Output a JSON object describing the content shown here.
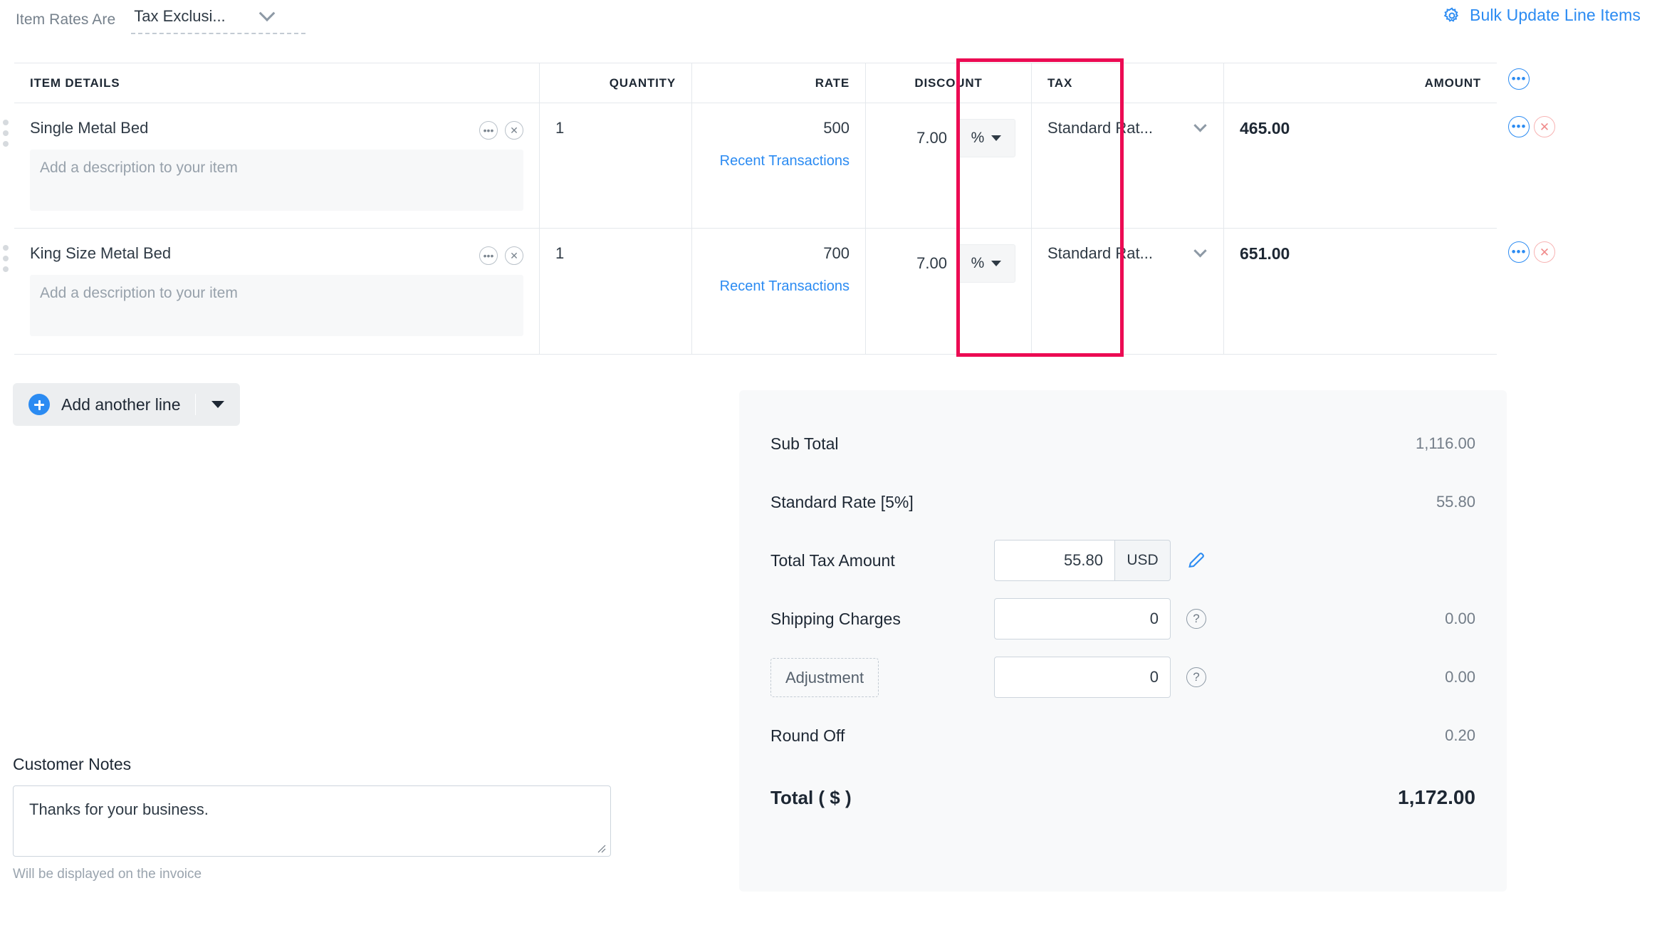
{
  "toolbar": {
    "rates_label": "Item Rates Are",
    "rates_value": "Tax Exclusi...",
    "bulk_update_label": "Bulk Update Line Items",
    "gear_icon": "gear-icon",
    "chevron_icon": "chevron-down-icon"
  },
  "table": {
    "headers": {
      "item_details": "ITEM DETAILS",
      "quantity": "QUANTITY",
      "rate": "RATE",
      "discount": "DISCOUNT",
      "tax": "TAX",
      "amount": "AMOUNT"
    },
    "header_more_icon": "more-options-icon",
    "description_placeholder": "Add a description to your item",
    "recent_transactions_label": "Recent Transactions",
    "rows": [
      {
        "name": "Single Metal Bed",
        "quantity": "1",
        "rate": "500",
        "discount": "7.00",
        "discount_unit": "%",
        "tax": "Standard Rat...",
        "amount": "465.00",
        "description": "",
        "description_placeholder": "Add a description to your item"
      },
      {
        "name": "King Size Metal Bed",
        "quantity": "1",
        "rate": "700",
        "discount": "7.00",
        "discount_unit": "%",
        "tax": "Standard Rat...",
        "amount": "651.00",
        "description": "",
        "description_placeholder": "Add a description to your item"
      }
    ]
  },
  "highlight": {
    "color": "#ec0b53",
    "target": "DISCOUNT"
  },
  "add_line": {
    "label": "Add another line",
    "plus_icon": "plus-circle-icon",
    "caret_icon": "caret-down-icon"
  },
  "summary": {
    "sub_total_label": "Sub Total",
    "sub_total_value": "1,116.00",
    "tax_rate_label": "Standard Rate [5%]",
    "tax_rate_value": "55.80",
    "total_tax_label": "Total Tax Amount",
    "total_tax_value": "55.80",
    "total_tax_currency": "USD",
    "edit_icon": "pencil-icon",
    "shipping_label": "Shipping Charges",
    "shipping_value": "0",
    "shipping_amount": "0.00",
    "adjustment_label": "Adjustment",
    "adjustment_value": "0",
    "adjustment_amount": "0.00",
    "round_off_label": "Round Off",
    "round_off_value": "0.20",
    "total_label": "Total ( $ )",
    "total_value": "1,172.00",
    "help_icon": "help-circle-icon"
  },
  "notes": {
    "label": "Customer Notes",
    "value": "Thanks for your business.",
    "hint": "Will be displayed on the invoice"
  },
  "colors": {
    "accent_blue": "#2b8bf2",
    "highlight_pink": "#ec0b53",
    "text_dark": "#1d2733",
    "text_muted": "#97a1ab"
  }
}
